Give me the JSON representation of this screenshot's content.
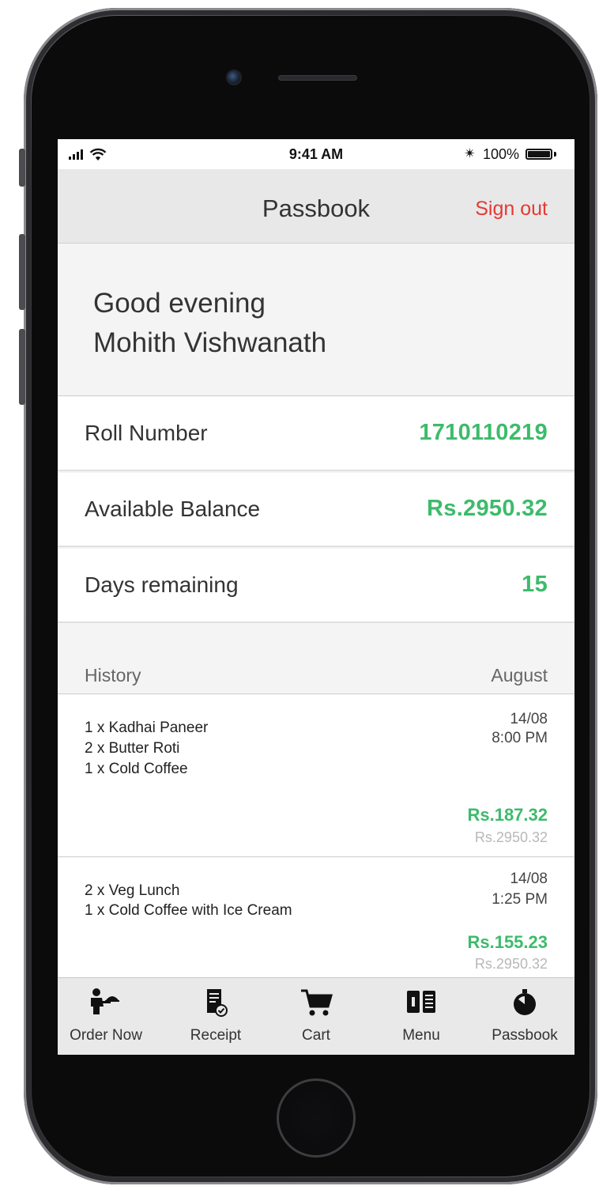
{
  "status_bar": {
    "time": "9:41 AM",
    "battery": "100%"
  },
  "nav": {
    "title": "Passbook",
    "sign_out": "Sign out"
  },
  "greeting": {
    "salutation": "Good evening",
    "name": "Mohith Vishwanath"
  },
  "info": {
    "roll": {
      "label": "Roll Number",
      "value": "1710110219"
    },
    "balance": {
      "label": "Available Balance",
      "value": "Rs.2950.32"
    },
    "days": {
      "label": "Days remaining",
      "value": "15"
    }
  },
  "history": {
    "title": "History",
    "month": "August",
    "transactions": [
      {
        "items": [
          "1 x Kadhai Paneer",
          "2 x Butter Roti",
          "1 x Cold Coffee"
        ],
        "date": "14/08",
        "time": "8:00 PM",
        "amount": "Rs.187.32",
        "balance": "Rs.2950.32"
      },
      {
        "items": [
          "2 x Veg Lunch",
          "1 x Cold Coffee with Ice Cream"
        ],
        "date": "14/08",
        "time": "1:25 PM",
        "amount": "Rs.155.23",
        "balance": "Rs.2950.32"
      }
    ]
  },
  "tabs": [
    {
      "label": "Order Now",
      "icon": "waiter-icon"
    },
    {
      "label": "Receipt",
      "icon": "receipt-icon"
    },
    {
      "label": "Cart",
      "icon": "cart-icon"
    },
    {
      "label": "Menu",
      "icon": "menu-book-icon"
    },
    {
      "label": "Passbook",
      "icon": "passbook-timer-icon"
    }
  ],
  "colors": {
    "accent_green": "#3dbb6b",
    "sign_out_red": "#e53935"
  }
}
